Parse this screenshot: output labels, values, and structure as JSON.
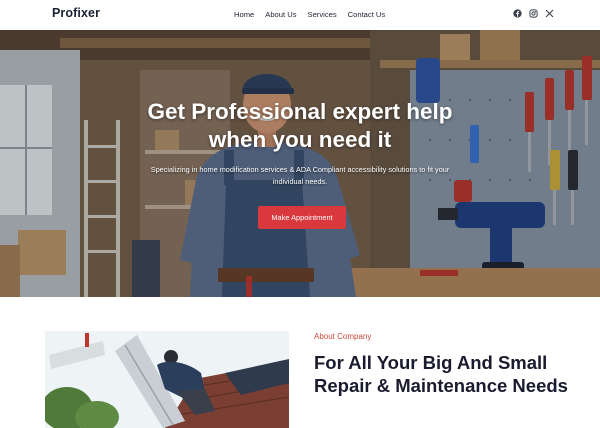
{
  "brand": {
    "name": "Profixer"
  },
  "nav": {
    "items": [
      {
        "label": "Home"
      },
      {
        "label": "About Us"
      },
      {
        "label": "Services"
      },
      {
        "label": "Contact Us"
      }
    ]
  },
  "social": {
    "icons": [
      "facebook-icon",
      "instagram-icon",
      "x-icon"
    ]
  },
  "hero": {
    "title": "Get Professional expert help when you need it",
    "subtitle": "Specializing in home modification services & ADA Compliant accessibility solutions to fit your individual needs.",
    "cta_label": "Make Appointment"
  },
  "about": {
    "label": "About Company",
    "title": "For All Your Big And Small Repair & Maintenance Needs"
  },
  "colors": {
    "accent": "#d9383d",
    "label": "#c94a3c",
    "text_dark": "#1b1b2f"
  }
}
